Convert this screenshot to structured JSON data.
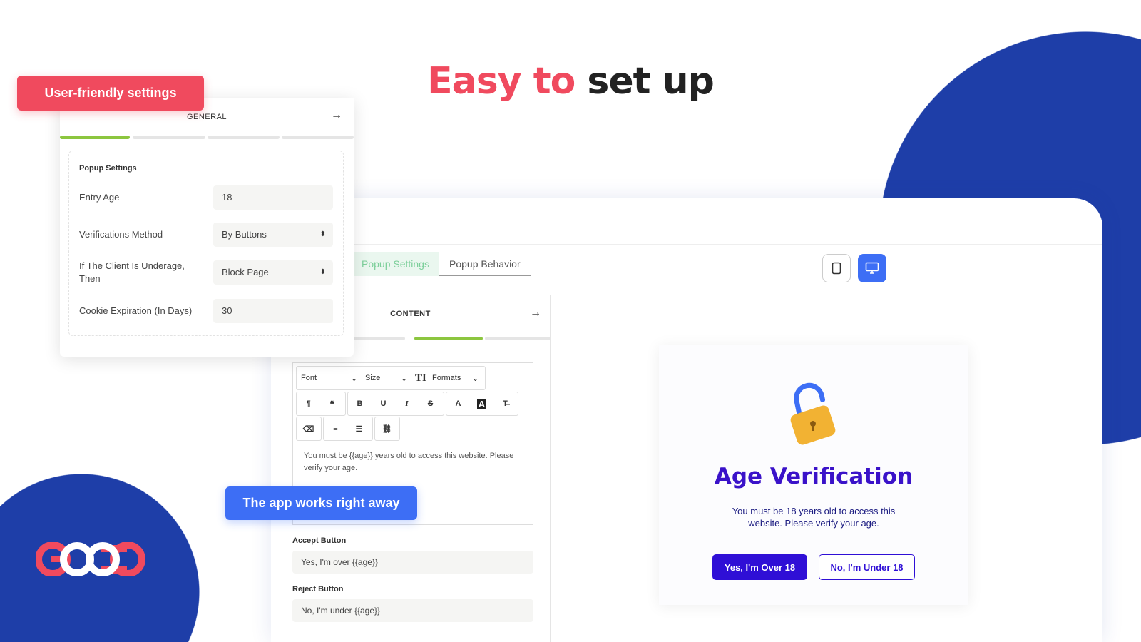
{
  "headline": {
    "part1": "Easy to",
    "part2": "set up"
  },
  "badges": {
    "settings": "User-friendly settings",
    "works": "The app works right away"
  },
  "colors": {
    "accent_red": "#f04a5e",
    "brand_blue": "#1e3ea8",
    "button_blue": "#3d6ef5",
    "popup_purple": "#2f0fd6",
    "progress_green": "#8cc63f"
  },
  "settings_card": {
    "title": "GENERAL",
    "section": "Popup Settings",
    "progress_step": 1,
    "progress_total": 4,
    "rows": [
      {
        "label": "Entry Age",
        "value": "18"
      },
      {
        "label": "Verifications Method",
        "value": "By Buttons"
      },
      {
        "label": "If The Client Is Underage, Then",
        "value": "Block Page"
      },
      {
        "label": "Cookie Expiration (In Days)",
        "value": "30"
      }
    ]
  },
  "breadcrumb": [
    "Popup Settings",
    "Popup Behavior"
  ],
  "devices": {
    "mobile": "mobile-icon",
    "desktop": "desktop-icon",
    "active": "desktop"
  },
  "content": {
    "title": "CONTENT",
    "progress_step": 2,
    "progress_total": 3,
    "toolbar": {
      "font": "Font",
      "size": "Size",
      "formats": "Formats"
    },
    "editor_text": "You must be {{age}} years old to access this website. Please verify your age.",
    "accept_label": "Accept Button",
    "accept_value": "Yes, I'm over {{age}}",
    "reject_label": "Reject Button",
    "reject_value": "No, I'm under {{age}}"
  },
  "preview": {
    "title": "Age Verification",
    "text": "You must be 18 years old to access this website. Please verify your age.",
    "accept": "Yes, I'm Over 18",
    "reject": "No, I'm Under 18"
  },
  "logo": {
    "text": "GOOO"
  }
}
